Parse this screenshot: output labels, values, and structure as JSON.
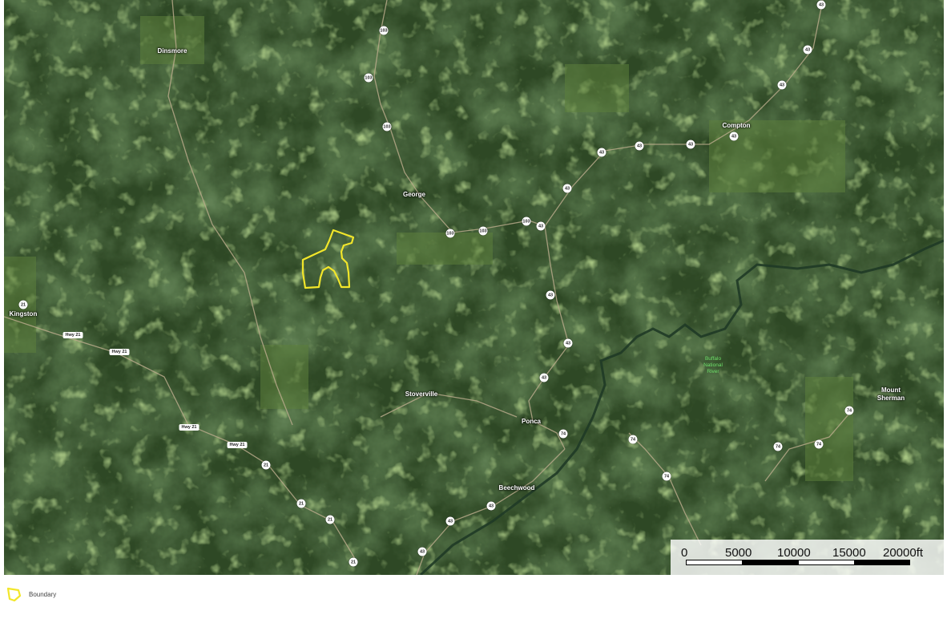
{
  "map": {
    "towns": [
      {
        "name": "Dinsmore"
      },
      {
        "name": "George"
      },
      {
        "name": "Compton"
      },
      {
        "name": "Kingston"
      },
      {
        "name": "Stoverville"
      },
      {
        "name": "Ponca"
      },
      {
        "name": "Mount Sherman"
      },
      {
        "name": "Beechwood"
      }
    ],
    "river_label": "Buffalo National River",
    "route_shields": [
      "43",
      "103",
      "103",
      "103",
      "43",
      "43",
      "43",
      "43",
      "43",
      "103",
      "103",
      "103",
      "43",
      "43",
      "43",
      "43",
      "43",
      "43",
      "74",
      "74",
      "74",
      "74",
      "74",
      "21",
      "74",
      "21",
      "21",
      "21",
      "21",
      "43",
      "43",
      "43"
    ],
    "highway_labels": [
      "Hwy 21",
      "Hwy 21",
      "Hwy 21",
      "Hwy 21"
    ],
    "boundary_color": "#f2e62a"
  },
  "scale_bar": {
    "labels": [
      "0",
      "5000",
      "10000",
      "15000",
      "20000ft"
    ]
  },
  "legend": {
    "label": "Boundary",
    "icon": "boundary-polygon-icon",
    "color": "#f2e62a"
  }
}
